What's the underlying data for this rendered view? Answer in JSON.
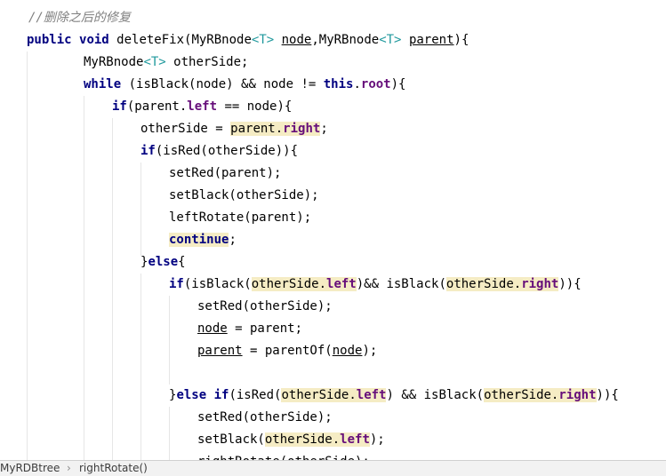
{
  "editor": {
    "lines": [
      [
        {
          "t": "//删除之后的修复",
          "s": "comment"
        }
      ],
      [
        {
          "t": "public",
          "s": "kw"
        },
        {
          "t": " "
        },
        {
          "t": "void",
          "s": "kw"
        },
        {
          "t": " deleteFix(MyRBnode"
        },
        {
          "t": "<T>",
          "s": "gen"
        },
        {
          "t": " "
        },
        {
          "t": "node",
          "s": "ul"
        },
        {
          "t": ",MyRBnode"
        },
        {
          "t": "<T>",
          "s": "gen"
        },
        {
          "t": " "
        },
        {
          "t": "parent",
          "s": "ul"
        },
        {
          "t": "){"
        }
      ],
      [
        {
          "t": "MyRBnode"
        },
        {
          "t": "<T>",
          "s": "gen"
        },
        {
          "t": " otherSide;"
        }
      ],
      [
        {
          "t": "while",
          "s": "kw"
        },
        {
          "t": " (isBlack(node) && node != "
        },
        {
          "t": "this",
          "s": "kw"
        },
        {
          "t": "."
        },
        {
          "t": "root",
          "s": "field"
        },
        {
          "t": "){"
        }
      ],
      [
        {
          "t": "if",
          "s": "kw"
        },
        {
          "t": "(parent."
        },
        {
          "t": "left",
          "s": "field"
        },
        {
          "t": " == node){"
        }
      ],
      [
        {
          "t": "otherSide = "
        },
        {
          "t": "parent.",
          "s": "hl"
        },
        {
          "t": "right",
          "s": "hl field"
        },
        {
          "t": ";"
        }
      ],
      [
        {
          "t": "if",
          "s": "kw"
        },
        {
          "t": "(isRed(otherSide)){"
        }
      ],
      [
        {
          "t": "setRed(parent);"
        }
      ],
      [
        {
          "t": "setBlack(otherSide);"
        }
      ],
      [
        {
          "t": "leftRotate(parent);"
        }
      ],
      [
        {
          "t": "continue",
          "s": "kw hl"
        },
        {
          "t": ";"
        }
      ],
      [
        {
          "t": "}"
        },
        {
          "t": "else",
          "s": "kw"
        },
        {
          "t": "{"
        }
      ],
      [
        {
          "t": "if",
          "s": "kw"
        },
        {
          "t": "(isBlack("
        },
        {
          "t": "otherSide.",
          "s": "hl"
        },
        {
          "t": "left",
          "s": "hl field"
        },
        {
          "t": ")&& isBlack("
        },
        {
          "t": "otherSide.",
          "s": "hl"
        },
        {
          "t": "right",
          "s": "hl field"
        },
        {
          "t": ")){"
        }
      ],
      [
        {
          "t": "setRed(otherSide);"
        }
      ],
      [
        {
          "t": "node",
          "s": "ul"
        },
        {
          "t": " = parent;"
        }
      ],
      [
        {
          "t": "parent",
          "s": "ul"
        },
        {
          "t": " = parentOf("
        },
        {
          "t": "node",
          "s": "ul"
        },
        {
          "t": ");"
        }
      ],
      [],
      [
        {
          "t": "}"
        },
        {
          "t": "else",
          "s": "kw"
        },
        {
          "t": " "
        },
        {
          "t": "if",
          "s": "kw"
        },
        {
          "t": "(isRed("
        },
        {
          "t": "otherSide.",
          "s": "hl"
        },
        {
          "t": "left",
          "s": "hl field"
        },
        {
          "t": ") && isBlack("
        },
        {
          "t": "otherSide.",
          "s": "hl"
        },
        {
          "t": "right",
          "s": "hl field"
        },
        {
          "t": ")){"
        }
      ],
      [
        {
          "t": "setRed(otherSide);"
        }
      ],
      [
        {
          "t": "setBlack("
        },
        {
          "t": "otherSide.",
          "s": "hl"
        },
        {
          "t": "left",
          "s": "hl field"
        },
        {
          "t": ");"
        }
      ],
      [
        {
          "t": "rightRotate(otherSide);"
        }
      ]
    ]
  },
  "status_bar": {
    "breadcrumb_class": "MyRDBtree",
    "separator": "›",
    "breadcrumb_method": "rightRotate()"
  }
}
